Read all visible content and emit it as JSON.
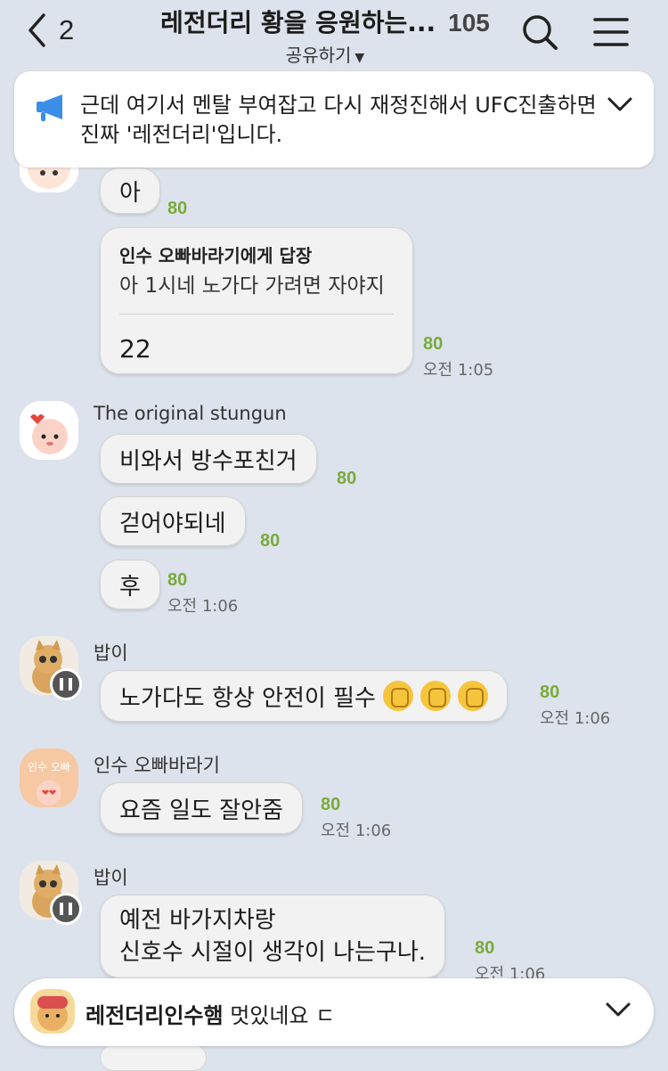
{
  "header": {
    "back_count": "2",
    "title": "레전더리 황을 응원하는...",
    "member_count": "105",
    "subtitle": "공유하기"
  },
  "notice": {
    "text": "근데 여기서 멘탈 부여잡고 다시 재정진해서 UFC진출하면 진짜 '레전더리'입니다."
  },
  "messages": [
    {
      "text": "아",
      "unread": "80"
    },
    {
      "reply_to": "인수 오빠바라기에게 답장",
      "quoted": "아 1시네 노가다 가려면 자야지",
      "text": "22",
      "unread": "80",
      "time": "오전 1:05"
    },
    {
      "sender": "The original stungun",
      "text": "비와서 방수포친거",
      "unread": "80"
    },
    {
      "text": "걷어야되네",
      "unread": "80"
    },
    {
      "text": "후",
      "unread": "80",
      "time": "오전 1:06"
    },
    {
      "sender": "밥이",
      "text": "노가다도 항상 안전이 필수",
      "emojis": [
        "fist-emoji",
        "fist-emoji",
        "fist-emoji"
      ],
      "unread": "80",
      "time": "오전 1:06"
    },
    {
      "sender": "인수 오빠바라기",
      "avatar_text": "인수 오빠",
      "text": "요즘 일도 잘안줌",
      "unread": "80",
      "time": "오전 1:06"
    },
    {
      "sender": "밥이",
      "line1": "예전 바가지차랑",
      "line2": "신호수 시절이 생각이 나는구나.",
      "unread": "80",
      "time": "오전 1:06"
    }
  ],
  "bottom_bar": {
    "sender": "레전더리인수햄",
    "text": "멋있네요 ㄷ"
  },
  "colors": {
    "background": "#dde3ec",
    "unread_green": "#7aab3a",
    "notice_icon_blue": "#3b8ee8"
  }
}
